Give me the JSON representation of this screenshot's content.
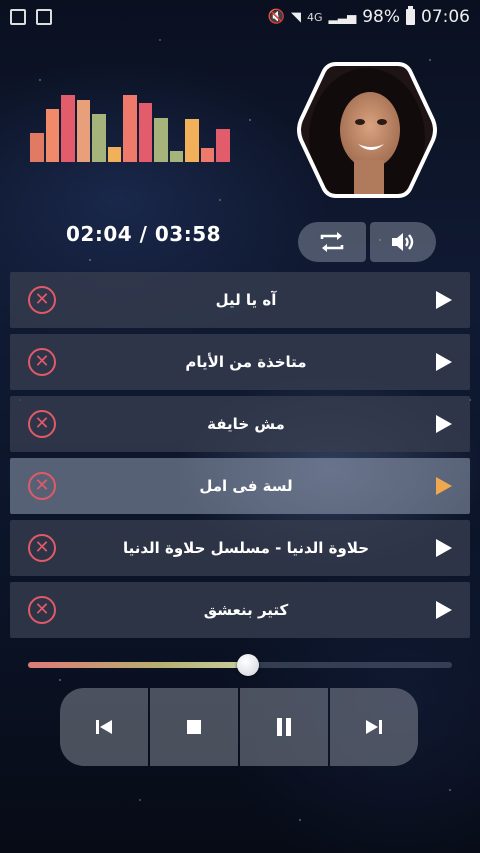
{
  "status_bar": {
    "network_label": "4G",
    "battery_text": "98%",
    "time": "07:06"
  },
  "visualizer": {
    "bars": [
      {
        "level": 0.38,
        "color": "#e07a62"
      },
      {
        "level": 0.7,
        "color": "#f08a6a"
      },
      {
        "level": 0.88,
        "color": "#e25c6c"
      },
      {
        "level": 0.82,
        "color": "#e8a07a"
      },
      {
        "level": 0.63,
        "color": "#a6b37a"
      },
      {
        "level": 0.2,
        "color": "#f2b05a"
      },
      {
        "level": 0.88,
        "color": "#ef7a6c"
      },
      {
        "level": 0.78,
        "color": "#e25c6c"
      },
      {
        "level": 0.58,
        "color": "#a6b37a"
      },
      {
        "level": 0.14,
        "color": "#a6b37a"
      },
      {
        "level": 0.56,
        "color": "#f2b05a"
      },
      {
        "level": 0.18,
        "color": "#ef7a6c"
      },
      {
        "level": 0.43,
        "color": "#e25c6c"
      }
    ]
  },
  "player": {
    "time_display": "02:04 / 03:58",
    "progress": 0.52,
    "accent": "#f0a850",
    "delete_color": "#e05a68"
  },
  "playlist": [
    {
      "title": "آه يا ليل",
      "active": false
    },
    {
      "title": "متاخذة من الأيام",
      "active": false
    },
    {
      "title": "مش خايفة",
      "active": false
    },
    {
      "title": "لسة فى امل",
      "active": true
    },
    {
      "title": "حلاوة الدنيا - مسلسل حلاوة الدنيا",
      "active": false
    },
    {
      "title": "كتير بنعشق",
      "active": false
    }
  ],
  "icons": {
    "repeat": "repeat-icon",
    "volume": "volume-icon",
    "delete": "close-circle-icon",
    "play": "play-icon",
    "previous": "skip-previous-icon",
    "stop": "stop-icon",
    "pause": "pause-icon",
    "next": "skip-next-icon"
  }
}
